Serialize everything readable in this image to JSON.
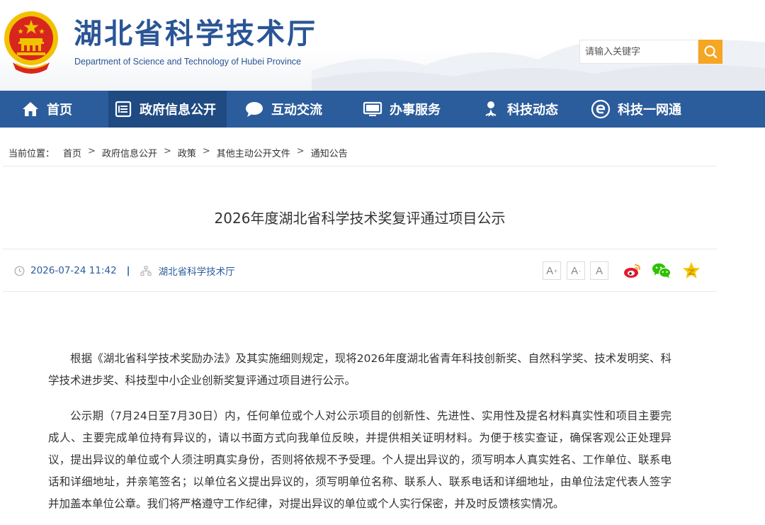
{
  "header": {
    "site_title": "湖北省科学技术厅",
    "site_subtitle": "Department of Science and Technology of Hubei Province",
    "search_placeholder": "请输入关键字",
    "colors": {
      "brand_blue": "#2b5c9c",
      "search_accent": "#f5a623",
      "emblem_red": "#d7261e",
      "emblem_gold": "#f2c200"
    }
  },
  "nav": {
    "items": [
      {
        "label": "首页",
        "icon": "home-icon"
      },
      {
        "label": "政府信息公开",
        "icon": "document-list-icon"
      },
      {
        "label": "互动交流",
        "icon": "chat-bubble-icon"
      },
      {
        "label": "办事服务",
        "icon": "monitor-icon"
      },
      {
        "label": "科技动态",
        "icon": "person-badge-icon"
      },
      {
        "label": "科技一网通",
        "icon": "e-circle-icon"
      }
    ],
    "active_index": 1
  },
  "breadcrumb": {
    "prefix": "当前位置：",
    "items": [
      "首页",
      "政府信息公开",
      "政策",
      "其他主动公开文件",
      "通知公告"
    ],
    "separator": ">"
  },
  "article": {
    "title": "2026年度湖北省科学技术奖复评通过项目公示",
    "date": "2026-07-24 11:42",
    "meta_separator": "|",
    "source": "湖北省科学技术厅",
    "font_sizes": {
      "large": "A",
      "medium": "A",
      "small": "A"
    },
    "share_icons": [
      "weibo-icon",
      "wechat-icon",
      "favorite-star-icon"
    ],
    "paragraphs": [
      "根据《湖北省科学技术奖励办法》及其实施细则规定，现将2026年度湖北省青年科技创新奖、自然科学奖、技术发明奖、科学技术进步奖、科技型中小企业创新奖复评通过项目进行公示。",
      "公示期（7月24日至7月30日）内，任何单位或个人对公示项目的创新性、先进性、实用性及提名材料真实性和项目主要完成人、主要完成单位持有异议的，请以书面方式向我单位反映，并提供相关证明材料。为便于核实查证，确保客观公正处理异议，提出异议的单位或个人须注明真实身份，否则将依规不予受理。个人提出异议的，须写明本人真实姓名、工作单位、联系电话和详细地址，并亲笔签名；以单位名义提出异议的，须写明单位名称、联系人、联系电话和详细地址，由单位法定代表人签字并加盖本单位公章。我们将严格遵守工作纪律，对提出异议的单位或个人实行保密，并及时反馈核实情况。"
    ]
  }
}
